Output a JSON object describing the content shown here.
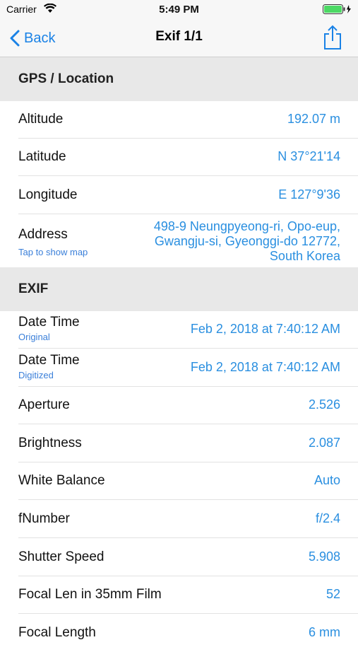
{
  "status_bar": {
    "carrier": "Carrier",
    "time": "5:49 PM"
  },
  "nav": {
    "back_label": "Back",
    "title": "Exif 1/1"
  },
  "sections": {
    "gps": {
      "title": "GPS / Location",
      "rows": [
        {
          "label": "Altitude",
          "value": "192.07 m"
        },
        {
          "label": "Latitude",
          "value": "N 37°21'14"
        },
        {
          "label": "Longitude",
          "value": "E 127°9'36"
        }
      ],
      "address": {
        "label": "Address",
        "sub": "Tap to show map",
        "line1": "498-9 Neungpyeong-ri, Opo-eup,",
        "line2": "Gwangju-si, Gyeonggi-do 12772,",
        "line3": "South Korea"
      }
    },
    "exif": {
      "title": "EXIF",
      "rows": [
        {
          "label": "Date Time",
          "sub": "Original",
          "value": "Feb 2, 2018 at 7:40:12 AM"
        },
        {
          "label": "Date Time",
          "sub": "Digitized",
          "value": "Feb 2, 2018 at 7:40:12 AM"
        },
        {
          "label": "Aperture",
          "value": "2.526"
        },
        {
          "label": "Brightness",
          "value": "2.087"
        },
        {
          "label": "White Balance",
          "value": "Auto"
        },
        {
          "label": "fNumber",
          "value": "f/2.4"
        },
        {
          "label": "Shutter Speed",
          "value": "5.908"
        },
        {
          "label": "Focal Len in 35mm Film",
          "value": "52"
        },
        {
          "label": "Focal Length",
          "value": "6 mm"
        }
      ]
    }
  },
  "colors": {
    "accent": "#1a82e6",
    "value_text": "#2a8fe0",
    "section_bg": "#e8e8e8"
  }
}
